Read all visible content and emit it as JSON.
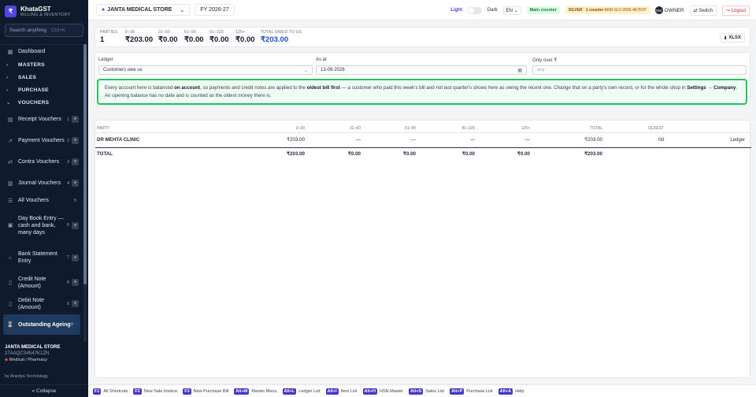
{
  "brand": {
    "logo": "₹",
    "name": "KhataGST",
    "subtitle": "BILLING & INVENTORY"
  },
  "search": {
    "placeholder": "Search anything",
    "shortcut": "Ctrl+K"
  },
  "nav": {
    "dashboard": "Dashboard",
    "sections": {
      "masters": "MASTERS",
      "sales": "SALES",
      "purchase": "PURCHASE",
      "vouchers": "VOUCHERS"
    },
    "items": [
      {
        "label": "Receipt Vouchers",
        "num": "1",
        "icon": "receipt-icon"
      },
      {
        "label": "Payment Vouchers",
        "num": "2",
        "icon": "payment-icon"
      },
      {
        "label": "Contra Vouchers",
        "num": "3",
        "icon": "contra-icon"
      },
      {
        "label": "Journal Vouchers",
        "num": "4",
        "icon": "journal-icon"
      },
      {
        "label": "All Vouchers",
        "num": "5",
        "icon": "list-icon"
      },
      {
        "label": "Day Book Entry — cash and bank, many days",
        "num": "6",
        "icon": "daybook-icon"
      },
      {
        "label": "Bank Statement Entry",
        "num": "7",
        "icon": "bank-icon"
      },
      {
        "label": "Credit Note (Amount)",
        "num": "8",
        "icon": "credit-note-icon"
      },
      {
        "label": "Debit Note (Amount)",
        "num": "9",
        "icon": "debit-note-icon"
      },
      {
        "label": "Outstanding Ageing",
        "num": "0",
        "icon": "ageing-icon"
      }
    ]
  },
  "store": {
    "name": "JANTA MEDICAL STORE",
    "gstin": "27AAQCS4547K1ZN",
    "type": "Medical / Pharmacy"
  },
  "footer": {
    "by": "by Anedya Technology",
    "collapse": "« Collapse"
  },
  "topbar": {
    "store": "JANTA MEDICAL STORE",
    "fy": "FY 2026-27",
    "theme_light": "Light",
    "theme_dark": "Dark",
    "lang": "EN",
    "counter": "Main counter",
    "license_plan": "SILVER · 1 counter",
    "license_key": "AND-SLV-2026-4E7F97",
    "owner_initials": "OW",
    "owner": "OWNER",
    "switch": "Switch",
    "logout": "Logout"
  },
  "stats": {
    "parties_label": "PARTIES",
    "parties": "1",
    "b0_label": "0–30",
    "b0": "₹203.00",
    "b1_label": "31–60",
    "b1": "₹0.00",
    "b2_label": "61–90",
    "b2": "₹0.00",
    "b3_label": "91–120",
    "b3": "₹0.00",
    "b4_label": "120+",
    "b4": "₹0.00",
    "owed_label": "TOTAL OWED TO US",
    "owed": "₹203.00",
    "export": "XLSX"
  },
  "filters": {
    "ledger_label": "Ledger",
    "ledger_value": "Customers owe us",
    "asat_label": "As at",
    "asat_value": "13-09-2026",
    "only_over_label": "Only over ₹",
    "only_over_placeholder": "any"
  },
  "info": {
    "t1": "Every account here is balanced ",
    "b1": "on account",
    "t2": ", so payments and credit notes are applied to the ",
    "b2": "oldest bill first",
    "t3": " — a customer who paid this week's bill and not last quarter's shows here as owing the recent one. Change that on a party's own record, or for the whole shop in ",
    "b3": "Settings → Company",
    "t4": ". An opening balance has no date and is counted as the oldest money there is."
  },
  "table": {
    "headers": {
      "party": "PARTY",
      "b0": "0–30",
      "b1": "31–60",
      "b2": "61–90",
      "b3": "91–120",
      "b4": "120+",
      "total": "TOTAL",
      "oldest": "OLDEST"
    },
    "row": {
      "party": "DR MEHTA CLINIC",
      "b0": "₹203.00",
      "b1": "—",
      "b2": "—",
      "b3": "—",
      "b4": "—",
      "total": "₹203.00",
      "oldest": "0d",
      "action": "Ledger"
    },
    "total": {
      "label": "TOTAL",
      "b0": "₹203.00",
      "b1": "₹0.00",
      "b2": "₹0.00",
      "b3": "₹0.00",
      "b4": "₹0.00",
      "total": "₹203.00"
    }
  },
  "shortcuts": [
    {
      "key": "F1",
      "label": "All Shortcuts"
    },
    {
      "key": "F2",
      "label": "New Sale Invoice"
    },
    {
      "key": "F3",
      "label": "New Purchase Bill"
    },
    {
      "key": "Alt+M",
      "label": "Master Menu"
    },
    {
      "key": "Alt+L",
      "label": "Ledger List"
    },
    {
      "key": "Alt+I",
      "label": "Item List"
    },
    {
      "key": "Alt+H",
      "label": "HSN Master"
    },
    {
      "key": "Alt+S",
      "label": "Sales List"
    },
    {
      "key": "Alt+P",
      "label": "Purchase List"
    },
    {
      "key": "Alt+A",
      "label": "Help"
    }
  ]
}
